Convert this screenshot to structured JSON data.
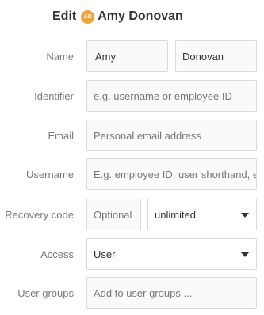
{
  "header": {
    "edit_label": "Edit",
    "avatar_initials": "AD",
    "user_name": "Amy Donovan"
  },
  "form": {
    "name_label": "Name",
    "first_name_value": "Amy",
    "last_name_value": "Donovan",
    "identifier_label": "Identifier",
    "identifier_placeholder": "e.g. username or employee ID",
    "email_label": "Email",
    "email_placeholder": "Personal email address",
    "username_label": "Username",
    "username_placeholder": "E.g. employee ID, user shorthand, e",
    "recovery_label": "Recovery code",
    "recovery_placeholder": "Optional",
    "recovery_select_value": "unlimited",
    "access_label": "Access",
    "access_select_value": "User",
    "groups_label": "User groups",
    "groups_placeholder": "Add to user groups ..."
  },
  "colors": {
    "avatar_bg": "#f2a33a",
    "field_border": "#d9d9d9",
    "label": "#7a7a7a"
  }
}
